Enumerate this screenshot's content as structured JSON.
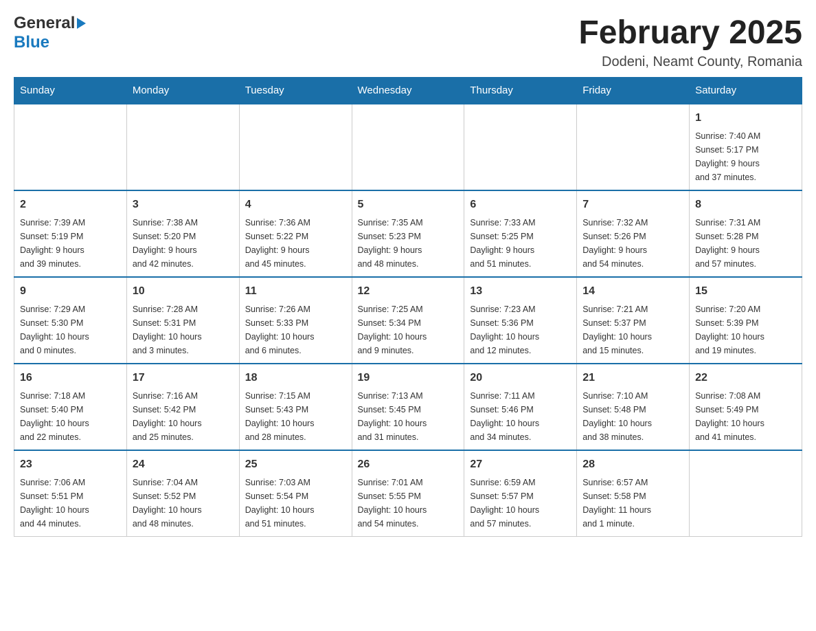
{
  "logo": {
    "general": "General",
    "blue": "Blue"
  },
  "title": "February 2025",
  "subtitle": "Dodeni, Neamt County, Romania",
  "days_of_week": [
    "Sunday",
    "Monday",
    "Tuesday",
    "Wednesday",
    "Thursday",
    "Friday",
    "Saturday"
  ],
  "weeks": [
    [
      {
        "day": "",
        "info": ""
      },
      {
        "day": "",
        "info": ""
      },
      {
        "day": "",
        "info": ""
      },
      {
        "day": "",
        "info": ""
      },
      {
        "day": "",
        "info": ""
      },
      {
        "day": "",
        "info": ""
      },
      {
        "day": "1",
        "info": "Sunrise: 7:40 AM\nSunset: 5:17 PM\nDaylight: 9 hours\nand 37 minutes."
      }
    ],
    [
      {
        "day": "2",
        "info": "Sunrise: 7:39 AM\nSunset: 5:19 PM\nDaylight: 9 hours\nand 39 minutes."
      },
      {
        "day": "3",
        "info": "Sunrise: 7:38 AM\nSunset: 5:20 PM\nDaylight: 9 hours\nand 42 minutes."
      },
      {
        "day": "4",
        "info": "Sunrise: 7:36 AM\nSunset: 5:22 PM\nDaylight: 9 hours\nand 45 minutes."
      },
      {
        "day": "5",
        "info": "Sunrise: 7:35 AM\nSunset: 5:23 PM\nDaylight: 9 hours\nand 48 minutes."
      },
      {
        "day": "6",
        "info": "Sunrise: 7:33 AM\nSunset: 5:25 PM\nDaylight: 9 hours\nand 51 minutes."
      },
      {
        "day": "7",
        "info": "Sunrise: 7:32 AM\nSunset: 5:26 PM\nDaylight: 9 hours\nand 54 minutes."
      },
      {
        "day": "8",
        "info": "Sunrise: 7:31 AM\nSunset: 5:28 PM\nDaylight: 9 hours\nand 57 minutes."
      }
    ],
    [
      {
        "day": "9",
        "info": "Sunrise: 7:29 AM\nSunset: 5:30 PM\nDaylight: 10 hours\nand 0 minutes."
      },
      {
        "day": "10",
        "info": "Sunrise: 7:28 AM\nSunset: 5:31 PM\nDaylight: 10 hours\nand 3 minutes."
      },
      {
        "day": "11",
        "info": "Sunrise: 7:26 AM\nSunset: 5:33 PM\nDaylight: 10 hours\nand 6 minutes."
      },
      {
        "day": "12",
        "info": "Sunrise: 7:25 AM\nSunset: 5:34 PM\nDaylight: 10 hours\nand 9 minutes."
      },
      {
        "day": "13",
        "info": "Sunrise: 7:23 AM\nSunset: 5:36 PM\nDaylight: 10 hours\nand 12 minutes."
      },
      {
        "day": "14",
        "info": "Sunrise: 7:21 AM\nSunset: 5:37 PM\nDaylight: 10 hours\nand 15 minutes."
      },
      {
        "day": "15",
        "info": "Sunrise: 7:20 AM\nSunset: 5:39 PM\nDaylight: 10 hours\nand 19 minutes."
      }
    ],
    [
      {
        "day": "16",
        "info": "Sunrise: 7:18 AM\nSunset: 5:40 PM\nDaylight: 10 hours\nand 22 minutes."
      },
      {
        "day": "17",
        "info": "Sunrise: 7:16 AM\nSunset: 5:42 PM\nDaylight: 10 hours\nand 25 minutes."
      },
      {
        "day": "18",
        "info": "Sunrise: 7:15 AM\nSunset: 5:43 PM\nDaylight: 10 hours\nand 28 minutes."
      },
      {
        "day": "19",
        "info": "Sunrise: 7:13 AM\nSunset: 5:45 PM\nDaylight: 10 hours\nand 31 minutes."
      },
      {
        "day": "20",
        "info": "Sunrise: 7:11 AM\nSunset: 5:46 PM\nDaylight: 10 hours\nand 34 minutes."
      },
      {
        "day": "21",
        "info": "Sunrise: 7:10 AM\nSunset: 5:48 PM\nDaylight: 10 hours\nand 38 minutes."
      },
      {
        "day": "22",
        "info": "Sunrise: 7:08 AM\nSunset: 5:49 PM\nDaylight: 10 hours\nand 41 minutes."
      }
    ],
    [
      {
        "day": "23",
        "info": "Sunrise: 7:06 AM\nSunset: 5:51 PM\nDaylight: 10 hours\nand 44 minutes."
      },
      {
        "day": "24",
        "info": "Sunrise: 7:04 AM\nSunset: 5:52 PM\nDaylight: 10 hours\nand 48 minutes."
      },
      {
        "day": "25",
        "info": "Sunrise: 7:03 AM\nSunset: 5:54 PM\nDaylight: 10 hours\nand 51 minutes."
      },
      {
        "day": "26",
        "info": "Sunrise: 7:01 AM\nSunset: 5:55 PM\nDaylight: 10 hours\nand 54 minutes."
      },
      {
        "day": "27",
        "info": "Sunrise: 6:59 AM\nSunset: 5:57 PM\nDaylight: 10 hours\nand 57 minutes."
      },
      {
        "day": "28",
        "info": "Sunrise: 6:57 AM\nSunset: 5:58 PM\nDaylight: 11 hours\nand 1 minute."
      },
      {
        "day": "",
        "info": ""
      }
    ]
  ]
}
